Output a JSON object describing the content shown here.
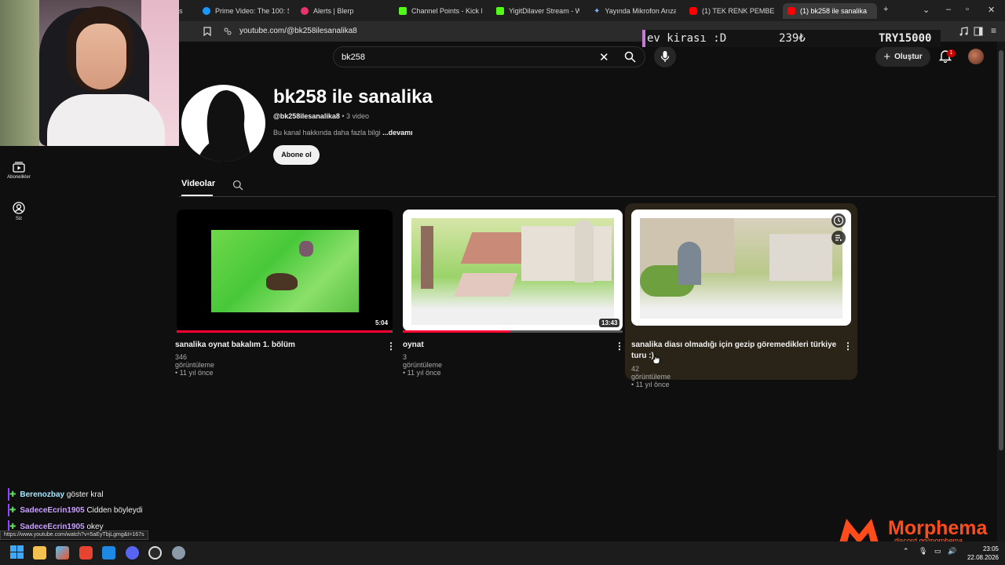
{
  "browser": {
    "tabs": [
      {
        "label": "s",
        "favicon_color": "#888888"
      },
      {
        "label": "Prime Video: The 100: Se",
        "favicon_color": "#1a98ff"
      },
      {
        "label": "Alerts | Blerp",
        "favicon_color": "#e8336d"
      },
      {
        "label": "Channel Points - Kick Das",
        "favicon_color": "#53fc18"
      },
      {
        "label": "YigitDilaver Stream - Wat",
        "favicon_color": "#53fc18"
      },
      {
        "label": "Yayında Mikrofon Arızası",
        "favicon_color": "#7cb4ff"
      },
      {
        "label": "(1) TEK RENK PEMBE",
        "favicon_color": "#ff0000"
      },
      {
        "label": "(1) bk258 ile sanalika",
        "favicon_color": "#ff0000"
      }
    ],
    "new_tab": "+",
    "url": "youtube.com/@bk258ilesanalika8",
    "status_url": "https://www.youtube.com/watch?v=5aEyTbjLgmg&t=167s"
  },
  "overlay": {
    "donation_text": "ev kirası :D",
    "donation_amount": "239₺",
    "donation_goal": "TRY15000"
  },
  "youtube": {
    "search_value": "bk258",
    "create_label": "Oluştur",
    "notification_count": "1",
    "sidebar": [
      {
        "label": "Abonelikler",
        "icon": "subscriptions-icon"
      },
      {
        "label": "Siz",
        "icon": "you-icon"
      }
    ],
    "channel": {
      "name": "bk258 ile sanalika",
      "handle": "@bk258ilesanalika8",
      "video_count": " • 3 video",
      "description": "Bu kanal hakkında daha fazla bilgi ",
      "more": "...devamı",
      "subscribe": "Abone ol",
      "tab_videos": "Videolar"
    },
    "videos": [
      {
        "title": "sanalika oynat bakalım 1. bölüm",
        "meta": "346 görüntüleme • 11 yıl önce",
        "duration": "5:04",
        "watched_fraction": 0.99
      },
      {
        "title": "oynat",
        "meta": "3 görüntüleme • 11 yıl önce",
        "duration": "13:43",
        "watched_fraction": 0.49
      },
      {
        "title_line1": "sanalika diası olmadığı için gezip göremedikleri türkiye",
        "title_line2": "turu :)",
        "meta": "42 görüntüleme • 11 yıl önce"
      }
    ]
  },
  "chat": [
    {
      "user": "Berenozbay",
      "message": " göster kral",
      "color": "#a8e6ff"
    },
    {
      "user": "SadeceEcrin1905",
      "message": " Cidden böyleydi",
      "color": "#c9a0ff"
    },
    {
      "user": "SadeceEcrin1905",
      "message": " okey",
      "color": "#c9a0ff"
    }
  ],
  "watermark": {
    "name": "Morphema",
    "url": "discord.gg/morphema"
  },
  "taskbar": {
    "time": "23:05",
    "date": "22.08.2026"
  }
}
